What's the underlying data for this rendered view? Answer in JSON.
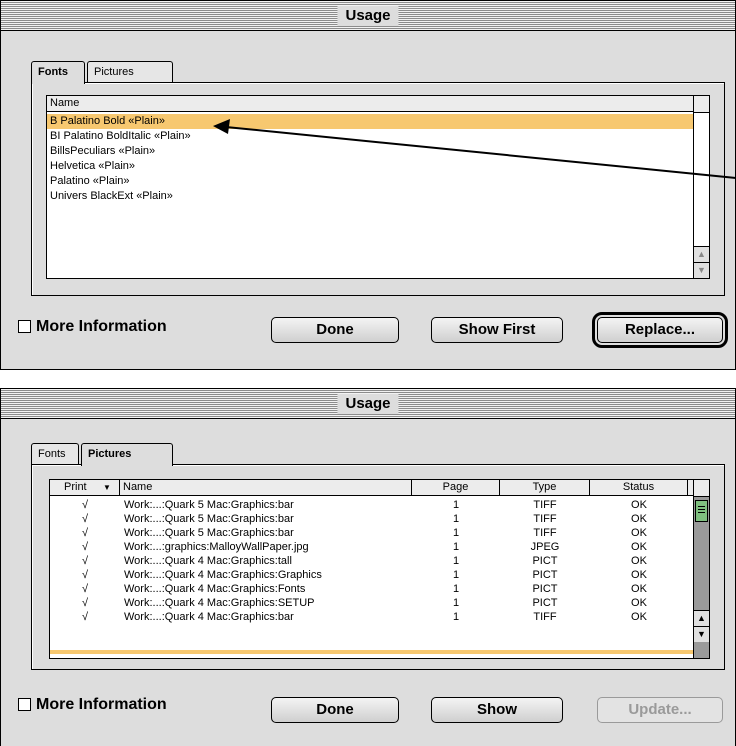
{
  "fonts_window": {
    "title": "Usage",
    "tabs": [
      {
        "label": "Fonts",
        "active": true
      },
      {
        "label": "Pictures",
        "active": false
      }
    ],
    "list": {
      "column_header": "Name",
      "items": [
        "B Palatino Bold «Plain»",
        "BI Palatino BoldItalic «Plain»",
        "BillsPeculiars «Plain»",
        "Helvetica «Plain»",
        "Palatino «Plain»",
        "Univers BlackExt «Plain»"
      ],
      "selected_index": 0
    },
    "more_information_label": "More Information",
    "buttons": {
      "done": "Done",
      "show_first": "Show First",
      "replace": "Replace..."
    }
  },
  "pictures_window": {
    "title": "Usage",
    "tabs": [
      {
        "label": "Fonts",
        "active": false
      },
      {
        "label": "Pictures",
        "active": true
      }
    ],
    "table": {
      "headers": {
        "print": "Print",
        "name": "Name",
        "page": "Page",
        "type": "Type",
        "status": "Status"
      },
      "rows": [
        {
          "print": "√",
          "name": "Work:...:Quark 5 Mac:Graphics:bar",
          "page": "1",
          "type": "TIFF",
          "status": "OK"
        },
        {
          "print": "√",
          "name": "Work:...:Quark 5 Mac:Graphics:bar",
          "page": "1",
          "type": "TIFF",
          "status": "OK"
        },
        {
          "print": "√",
          "name": "Work:...:Quark 5 Mac:Graphics:bar",
          "page": "1",
          "type": "TIFF",
          "status": "OK"
        },
        {
          "print": "√",
          "name": "Work:...:graphics:MalloyWallPaper.jpg",
          "page": "1",
          "type": "JPEG",
          "status": "OK"
        },
        {
          "print": "√",
          "name": "Work:...:Quark 4 Mac:Graphics:tall",
          "page": "1",
          "type": "PICT",
          "status": "OK"
        },
        {
          "print": "√",
          "name": "Work:...:Quark 4 Mac:Graphics:Graphics",
          "page": "1",
          "type": "PICT",
          "status": "OK"
        },
        {
          "print": "√",
          "name": "Work:...:Quark 4 Mac:Graphics:Fonts",
          "page": "1",
          "type": "PICT",
          "status": "OK"
        },
        {
          "print": "√",
          "name": "Work:...:Quark 4 Mac:Graphics:SETUP",
          "page": "1",
          "type": "PICT",
          "status": "OK"
        },
        {
          "print": "√",
          "name": "Work:...:Quark 4 Mac:Graphics:bar",
          "page": "1",
          "type": "TIFF",
          "status": "OK"
        }
      ]
    },
    "more_information_label": "More Information",
    "buttons": {
      "done": "Done",
      "show": "Show",
      "update": "Update..."
    }
  },
  "colors": {
    "selection": "#f7c870",
    "window_bg": "#dddddd",
    "scroll_thumb": "#7fbf7f"
  },
  "icons": {
    "scroll_up": "up-arrow-icon",
    "scroll_down": "down-arrow-icon",
    "print_menu": "triangle-down-icon"
  }
}
